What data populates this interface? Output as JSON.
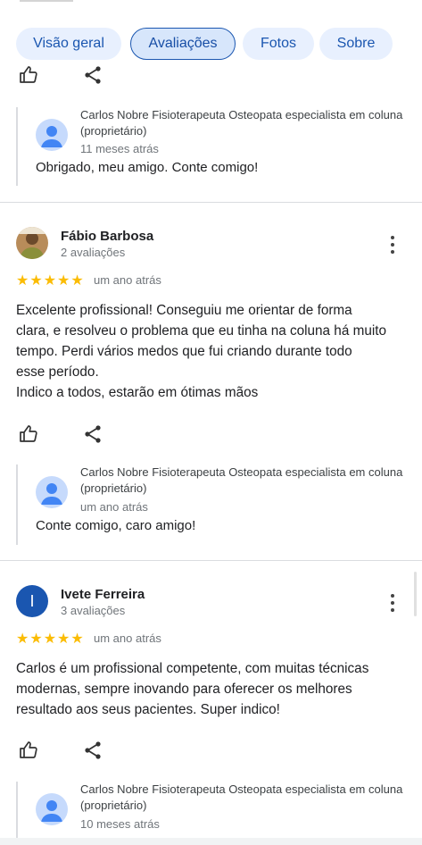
{
  "tabs": [
    {
      "label": "Visão geral"
    },
    {
      "label": "Avaliações"
    },
    {
      "label": "Fotos"
    },
    {
      "label": "Sobre"
    }
  ],
  "owner_name": "Carlos Nobre Fisioterapeuta Osteopata especialista em coluna (proprietário)",
  "reply0": {
    "when": "11 meses atrás",
    "text": "Obrigado, meu amigo. Conte comigo!"
  },
  "reviews": [
    {
      "name": "Fábio Barbosa",
      "count": "2 avaliações",
      "stars": "★★★★★",
      "ago": "um ano atrás",
      "body": [
        "Excelente profissional! Conseguiu me orientar de forma",
        "clara, e resolveu o problema que eu tinha na coluna há muito",
        "tempo. Perdi vários medos que fui criando durante todo",
        "esse período.",
        "Indico a todos, estarão em ótimas mãos"
      ],
      "reply": {
        "when": "um ano atrás",
        "text": "Conte comigo, caro amigo!"
      }
    },
    {
      "name": "Ivete Ferreira",
      "initial": "I",
      "count": "3 avaliações",
      "stars": "★★★★★",
      "ago": "um ano atrás",
      "body": [
        "Carlos é um profissional competente, com muitas técnicas",
        "modernas, sempre inovando para oferecer os melhores",
        "resultado aos seus pacientes. Super indico!"
      ],
      "reply": {
        "when": "10 meses atrás"
      }
    }
  ],
  "colors": {
    "accent": "#1a56b0",
    "star": "#fbbc04",
    "tab_bg": "#e8f0fe"
  },
  "icons": [
    "thumbs-up-icon",
    "share-icon",
    "more-vert-icon",
    "person-icon"
  ]
}
